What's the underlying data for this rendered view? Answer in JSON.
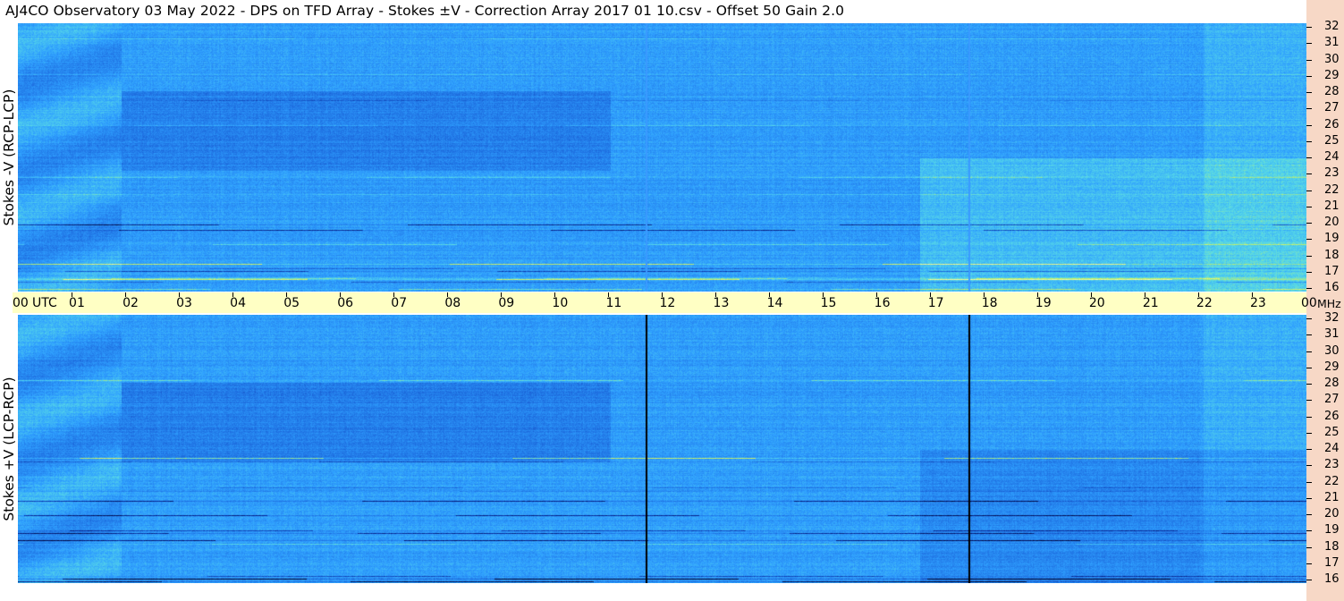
{
  "title": "AJ4CO Observatory  03 May 2022  -  DPS on TFD Array  -  Stokes ±V  -  Correction Array 2017 01 10.csv  -  Offset 50  Gain 2.0",
  "colors": {
    "background_panel": "#1e7fe0",
    "utc_strip": "#ffffc4",
    "right_axis": "#f7d8c6",
    "colormap": [
      "#000028",
      "#0a2a9a",
      "#1e6ee0",
      "#2fa0ff",
      "#56d8e8",
      "#c8f060",
      "#ffffa0",
      "#ff6060"
    ]
  },
  "chart_data": [
    {
      "type": "heatmap",
      "name": "Stokes -V (RCP-LCP)",
      "ylabel": "Stokes -V (RCP-LCP)",
      "xlabel": "UTC",
      "x_unit": "UTC",
      "y_unit": "MHz",
      "xlim": [
        0,
        24
      ],
      "ylim": [
        16,
        32
      ],
      "x_ticks": [
        "00",
        "01",
        "02",
        "03",
        "04",
        "05",
        "06",
        "07",
        "08",
        "09",
        "10",
        "11",
        "12",
        "13",
        "14",
        "15",
        "16",
        "17",
        "18",
        "19",
        "20",
        "21",
        "22",
        "23",
        "00"
      ],
      "y_ticks": [
        "16",
        "17",
        "18",
        "19",
        "20",
        "21",
        "22",
        "23",
        "24",
        "25",
        "26",
        "27",
        "28",
        "29",
        "30",
        "31",
        "32"
      ],
      "vertical_lines_utc": [
        11.7,
        17.7
      ],
      "vertical_lines_color": "#3a9aff"
    },
    {
      "type": "heatmap",
      "name": "Stokes +V (LCP-RCP)",
      "ylabel": "Stokes +V (LCP-RCP)",
      "xlabel": "UTC",
      "x_unit": "UTC",
      "y_unit": "MHz",
      "xlim": [
        0,
        24
      ],
      "ylim": [
        16,
        32
      ],
      "x_ticks": [
        "00",
        "01",
        "02",
        "03",
        "04",
        "05",
        "06",
        "07",
        "08",
        "09",
        "10",
        "11",
        "12",
        "13",
        "14",
        "15",
        "16",
        "17",
        "18",
        "19",
        "20",
        "21",
        "22",
        "23",
        "00"
      ],
      "y_ticks": [
        "16",
        "17",
        "18",
        "19",
        "20",
        "21",
        "22",
        "23",
        "24",
        "25",
        "26",
        "27",
        "28",
        "29",
        "30",
        "31",
        "32"
      ],
      "vertical_lines_utc": [
        11.7,
        17.7
      ],
      "vertical_lines_color": "#000000"
    }
  ],
  "utc_axis": {
    "start_label": "00",
    "unit_label": "UTC",
    "labels": [
      "01",
      "02",
      "03",
      "04",
      "05",
      "06",
      "07",
      "08",
      "09",
      "10",
      "11",
      "12",
      "13",
      "14",
      "15",
      "16",
      "17",
      "18",
      "19",
      "20",
      "21",
      "22",
      "23"
    ],
    "end_label": "00",
    "mhz_label": "MHz"
  }
}
